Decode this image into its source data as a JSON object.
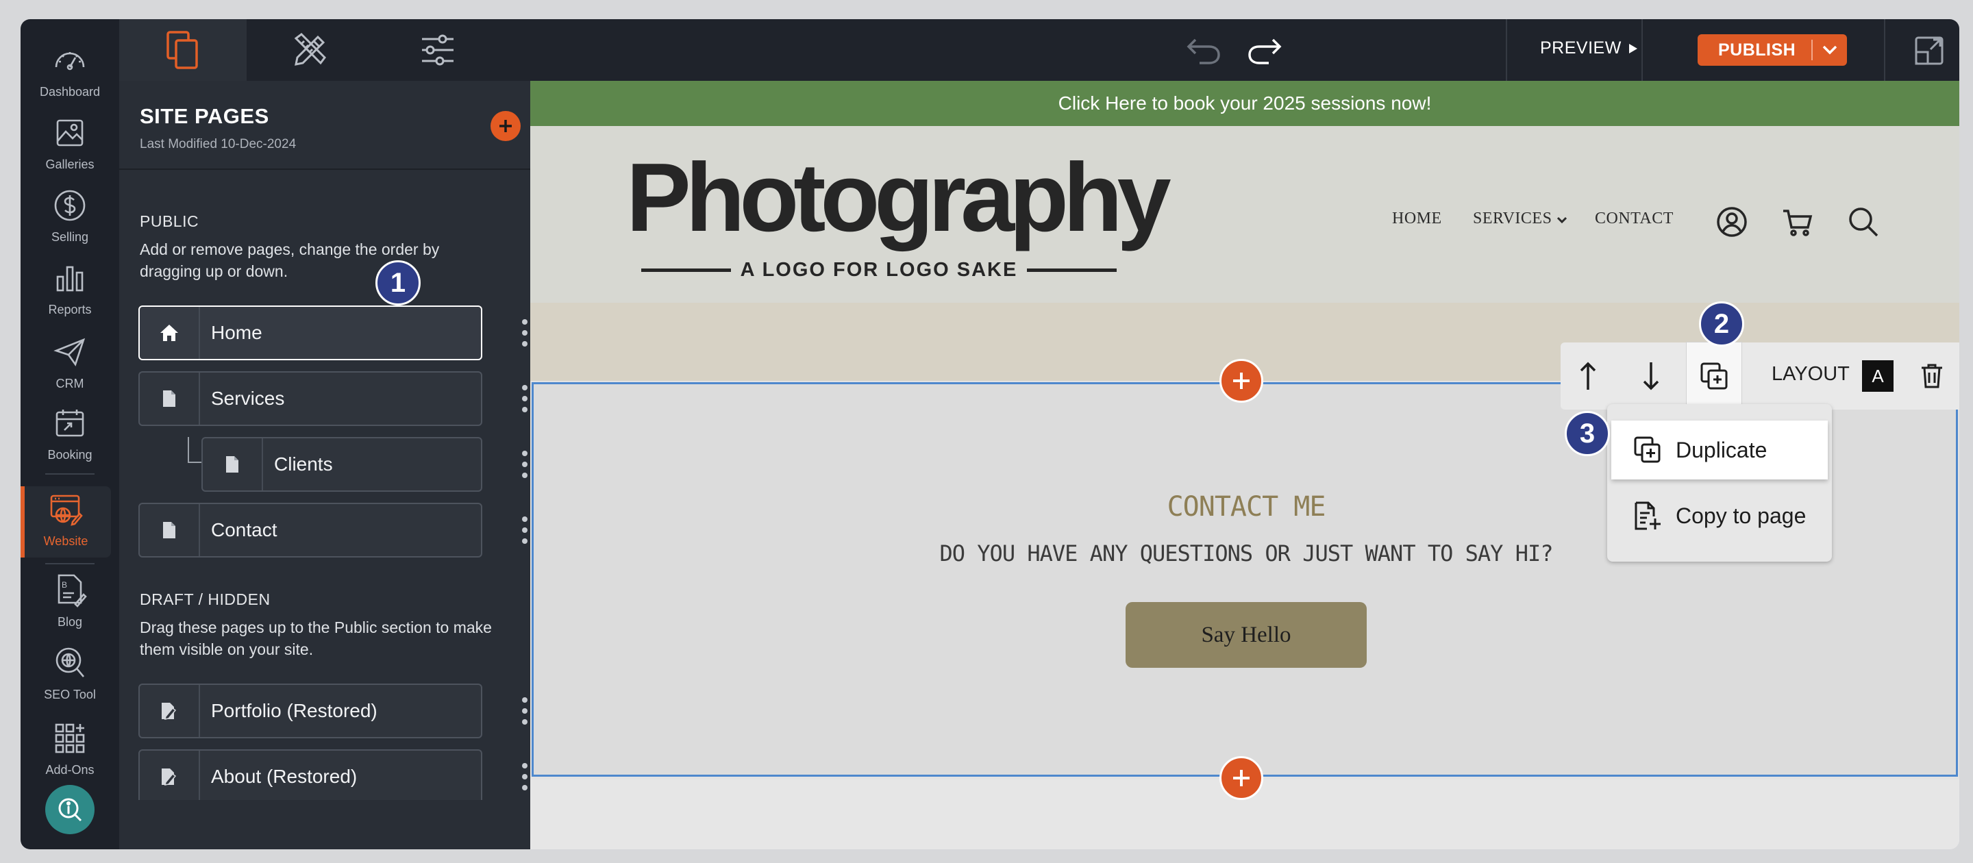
{
  "nav": {
    "items": [
      {
        "label": "Dashboard",
        "icon": "dashboard-gauge-icon"
      },
      {
        "label": "Galleries",
        "icon": "image-icon"
      },
      {
        "label": "Selling",
        "icon": "dollar-icon"
      },
      {
        "label": "Reports",
        "icon": "bar-chart-icon"
      },
      {
        "label": "CRM",
        "icon": "paper-plane-icon"
      },
      {
        "label": "Booking",
        "icon": "calendar-icon"
      },
      {
        "label": "Website",
        "icon": "website-icon"
      },
      {
        "label": "Blog",
        "icon": "blog-icon"
      },
      {
        "label": "SEO Tool",
        "icon": "seo-globe-icon"
      },
      {
        "label": "Add-Ons",
        "icon": "grid-plus-icon"
      }
    ],
    "active": "Website"
  },
  "toolbar": {
    "preview_label": "PREVIEW",
    "publish_label": "PUBLISH"
  },
  "panel": {
    "title": "SITE PAGES",
    "last_modified": "Last Modified 10-Dec-2024",
    "public_title": "PUBLIC",
    "public_desc": "Add or remove pages, change the order by dragging up or down.",
    "pages": [
      {
        "name": "Home",
        "icon": "home-icon",
        "selected": true
      },
      {
        "name": "Services",
        "icon": "page-icon"
      },
      {
        "name": "Clients",
        "icon": "page-icon",
        "child": true
      },
      {
        "name": "Contact",
        "icon": "page-icon"
      }
    ],
    "draft_title": "DRAFT / HIDDEN",
    "draft_desc": "Drag these pages up to the Public section to make them visible on your site.",
    "draft_pages": [
      {
        "name": "Portfolio (Restored)",
        "icon": "draft-page-icon"
      },
      {
        "name": "About (Restored)",
        "icon": "draft-page-icon"
      }
    ]
  },
  "badges": [
    "1",
    "2",
    "3"
  ],
  "site": {
    "banner": "Click Here to book your 2025 sessions now!",
    "logo_main": "Photography",
    "logo_sub": "A LOGO FOR LOGO SAKE",
    "menu": [
      "HOME",
      "SERVICES",
      "CONTACT"
    ],
    "contact_title": "CONTACT ME",
    "contact_sub": "DO YOU HAVE ANY QUESTIONS OR JUST WANT TO SAY HI?",
    "button": "Say Hello"
  },
  "section_tools": {
    "layout_label": "LAYOUT",
    "layout_value": "A"
  },
  "dropdown": {
    "items": [
      "Duplicate",
      "Copy to page"
    ]
  },
  "colors": {
    "accent": "#e05d29",
    "nav_bg": "#1d2129",
    "panel_bg": "#292e36",
    "banner": "#5d874c",
    "badge": "#2e3d88",
    "selection_border": "#4e88cd"
  }
}
